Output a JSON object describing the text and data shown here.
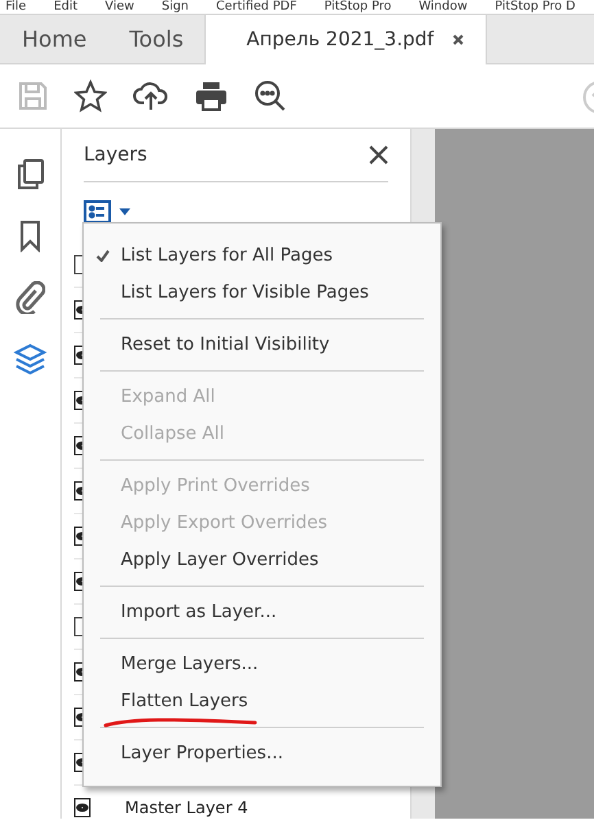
{
  "menu_bar": [
    "File",
    "Edit",
    "View",
    "Sign",
    "Certified PDF",
    "PitStop Pro",
    "Window",
    "PitStop Pro D"
  ],
  "tabs": [
    {
      "label": "Home",
      "selected": false
    },
    {
      "label": "Tools",
      "selected": false
    },
    {
      "label": "Апрель 2021_3.pdf",
      "selected": true,
      "closable": true
    }
  ],
  "panel": {
    "title": "Layers"
  },
  "layers": [
    {
      "visible": false
    },
    {
      "visible": true
    },
    {
      "visible": true
    },
    {
      "visible": true
    },
    {
      "visible": true
    },
    {
      "visible": true
    },
    {
      "visible": true
    },
    {
      "visible": true
    },
    {
      "visible": false
    },
    {
      "visible": true
    },
    {
      "visible": true
    },
    {
      "visible": true
    },
    {
      "name": "Master Layer 4",
      "visible": true
    }
  ],
  "context_menu": [
    {
      "kind": "item",
      "label": "List Layers for All Pages",
      "checked": true,
      "disabled": false
    },
    {
      "kind": "item",
      "label": "List Layers for Visible Pages",
      "checked": false,
      "disabled": false
    },
    {
      "kind": "separator"
    },
    {
      "kind": "item",
      "label": "Reset to Initial Visibility",
      "checked": false,
      "disabled": false
    },
    {
      "kind": "separator"
    },
    {
      "kind": "item",
      "label": "Expand All",
      "checked": false,
      "disabled": true
    },
    {
      "kind": "item",
      "label": "Collapse All",
      "checked": false,
      "disabled": true
    },
    {
      "kind": "separator"
    },
    {
      "kind": "item",
      "label": "Apply Print Overrides",
      "checked": false,
      "disabled": true
    },
    {
      "kind": "item",
      "label": "Apply Export Overrides",
      "checked": false,
      "disabled": true
    },
    {
      "kind": "item",
      "label": "Apply Layer Overrides",
      "checked": false,
      "disabled": false
    },
    {
      "kind": "separator"
    },
    {
      "kind": "item",
      "label": "Import as Layer...",
      "checked": false,
      "disabled": false
    },
    {
      "kind": "separator"
    },
    {
      "kind": "item",
      "label": "Merge Layers...",
      "checked": false,
      "disabled": false
    },
    {
      "kind": "item",
      "label": "Flatten Layers",
      "checked": false,
      "disabled": false,
      "annotated": true
    },
    {
      "kind": "separator"
    },
    {
      "kind": "item",
      "label": "Layer Properties...",
      "checked": false,
      "disabled": false
    }
  ]
}
